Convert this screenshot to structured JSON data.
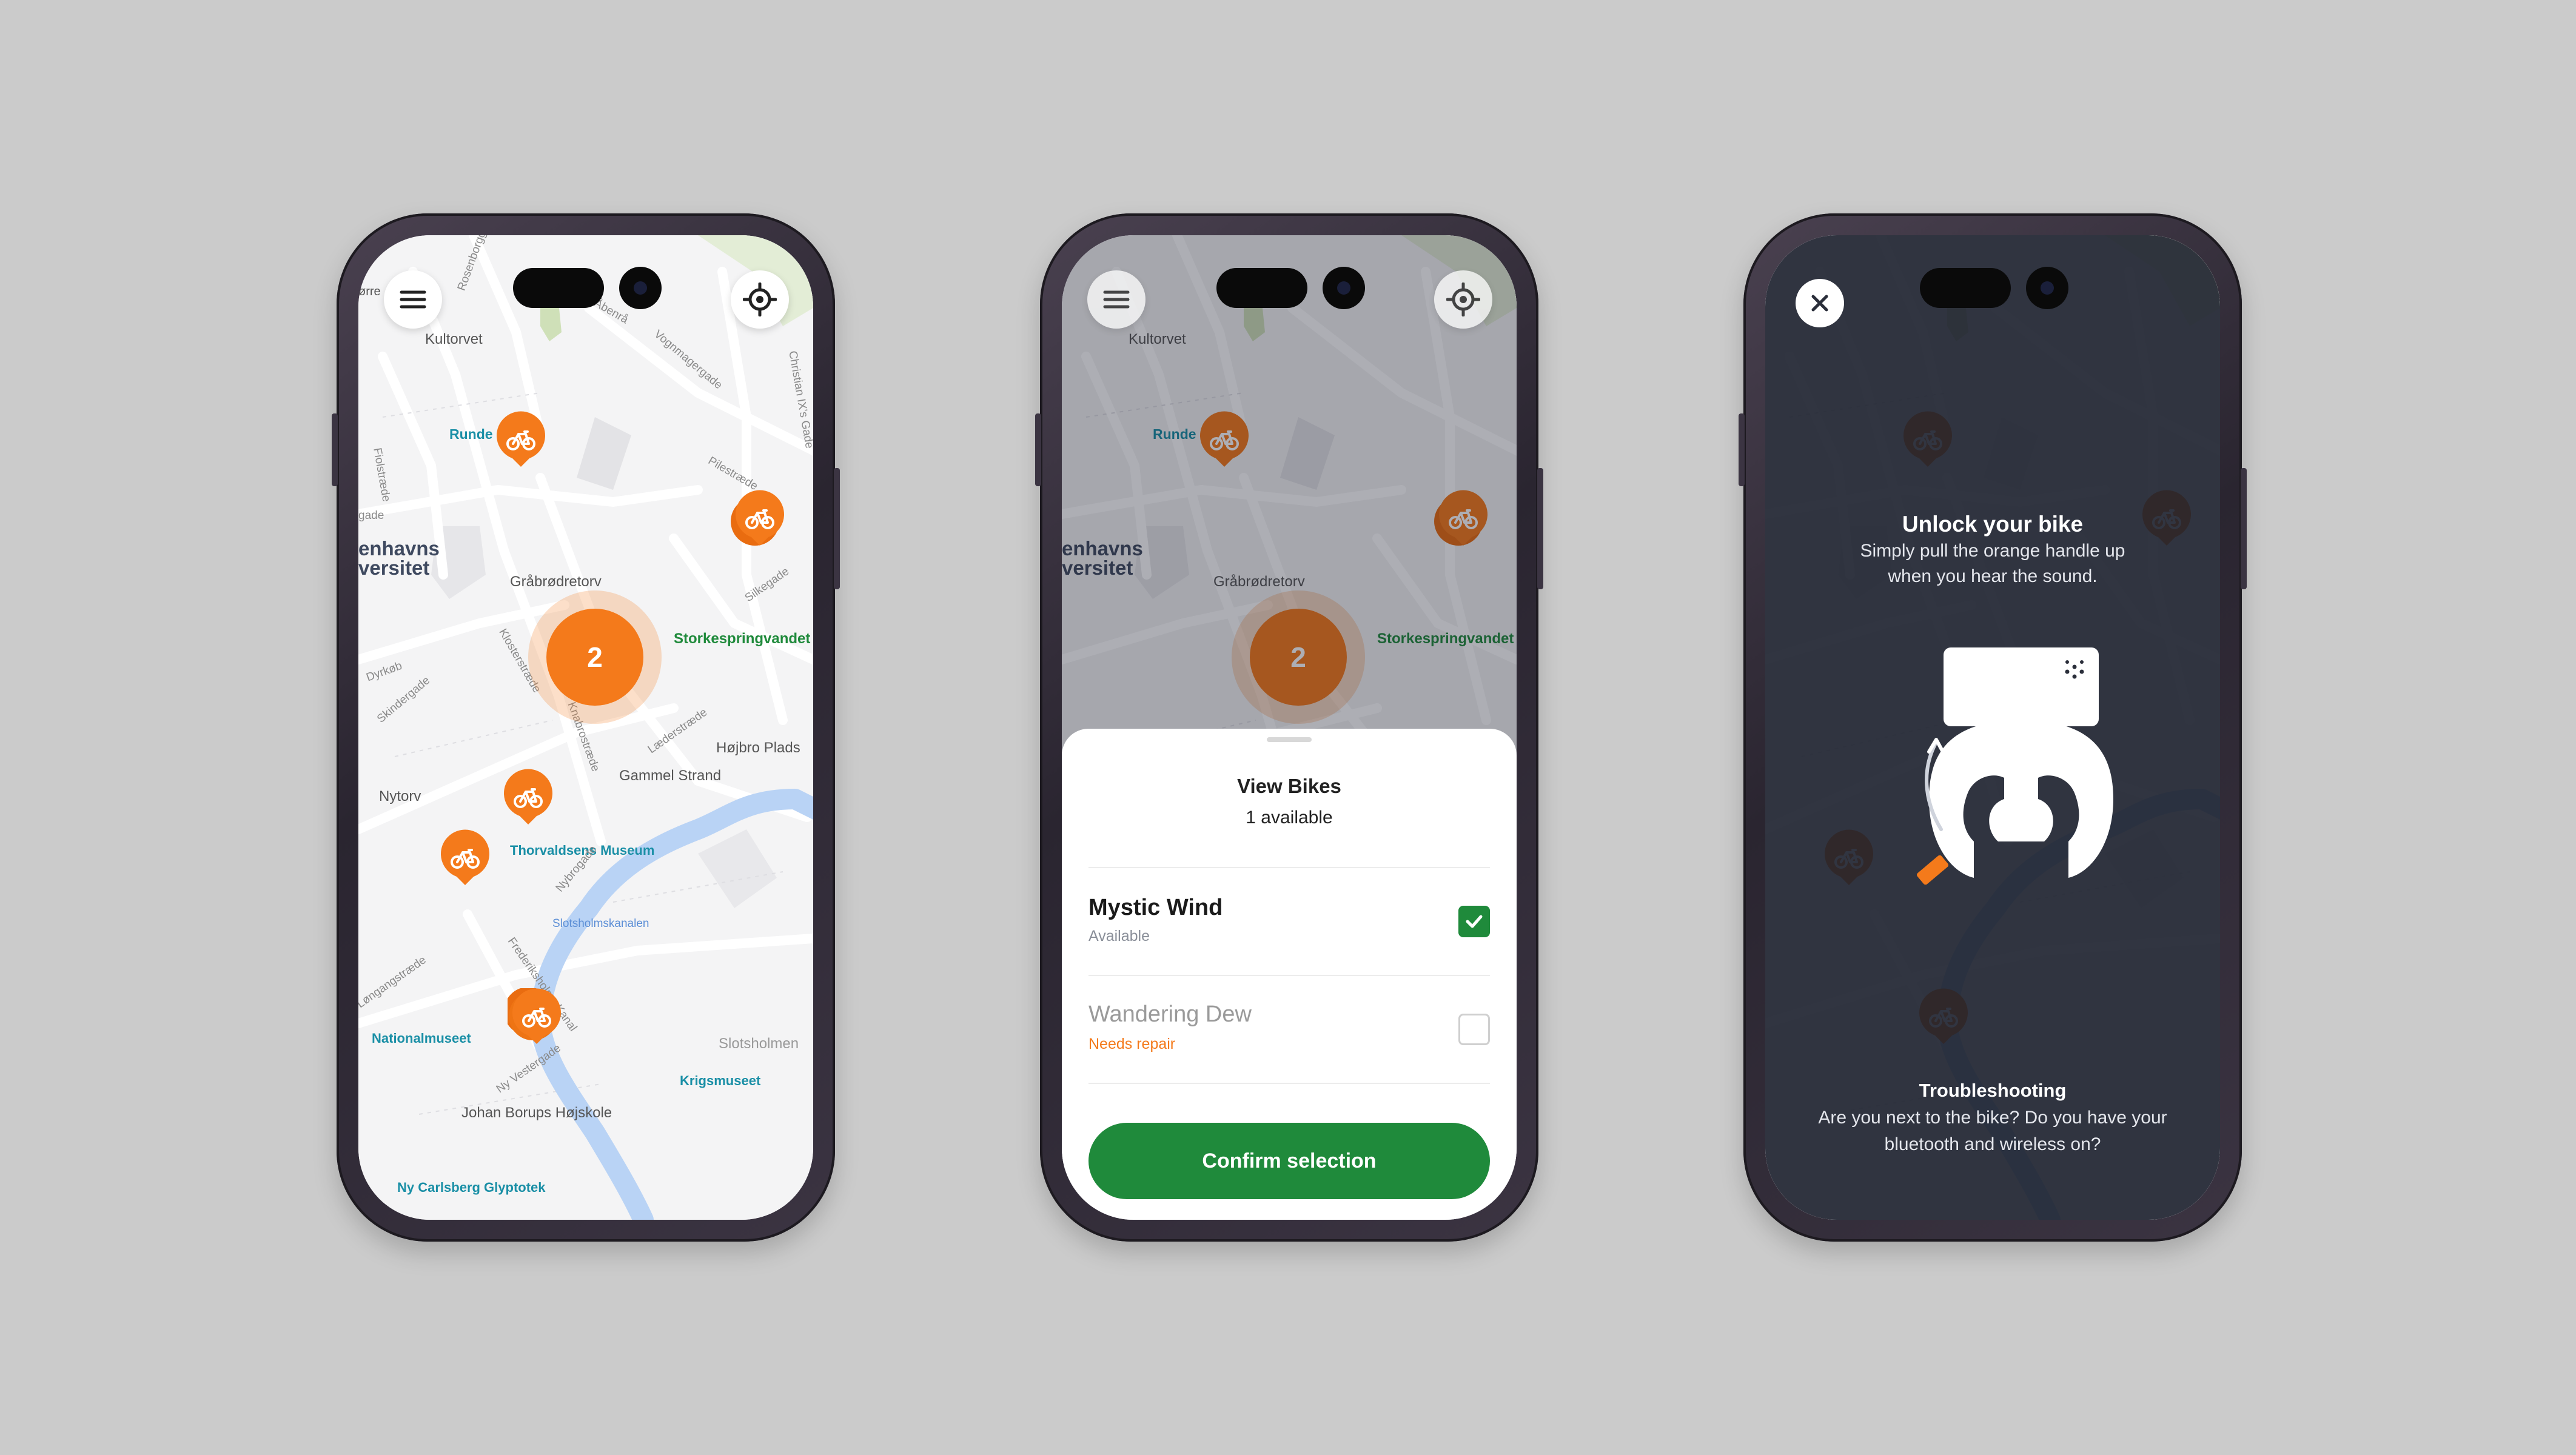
{
  "colors": {
    "background": "#cbcbcb",
    "accent_orange": "#f47a1b",
    "confirm_green": "#1f8a3b",
    "status_needs_repair": "#f47a1b",
    "status_available": "#8a8f99",
    "dark_overlay": "#1b1f2c"
  },
  "icons": {
    "menu": "hamburger-menu-icon",
    "locate": "crosshair-location-icon",
    "bike": "bicycle-icon",
    "check": "checkmark-icon",
    "close": "close-x-icon"
  },
  "map": {
    "labels": {
      "kultorvet": "Kultorvet",
      "runde": "Runde",
      "universitet_line1": "enhavns",
      "universitet_line2": "versitet",
      "grabrodretorv": "Gråbrødretorv",
      "storkespringvandet": "Storkespringvandet",
      "hojbro": "Højbro Plads",
      "gammel_strand": "Gammel Strand",
      "nytorv": "Nytorv",
      "thorvaldsens": "Thorvaldsens Museum",
      "slotsholmskanalen": "Slotsholmskanalen",
      "nationalmuseet": "Nationalmuseet",
      "slotsholmen": "Slotsholmen",
      "krigsmuseet": "Krigsmuseet",
      "johan_borups": "Johan Borups Højskole",
      "glyptotek": "Ny Carlsberg Glyptotek",
      "norre": "ørre"
    },
    "streets": {
      "rosenborggade": "Rosenborggade",
      "abenra": "Åbenrå",
      "vognmagergade": "Vognmagergade",
      "christian_ix": "Christian IX's Gade",
      "fiolstraede": "Fiolstræde",
      "pilestraede": "Pilestræde",
      "silkegade": "Silkegade",
      "klosterstraede": "Klosterstræde",
      "dyrkob": "Dyrkøb",
      "skindergade": "Skindergade",
      "laederstraede": "Læderstræde",
      "knabrostraede": "Knabrostræde",
      "nybrogade": "Nybrogade",
      "frederiksholms": "Frederiksholms Kanal",
      "langangstraede": "Løngangstræde",
      "ny_vestergade": "Ny Vestergade",
      "gade": "gade"
    },
    "cluster_count": "2"
  },
  "sheet": {
    "title": "View Bikes",
    "subtitle": "1 available",
    "bikes": [
      {
        "name": "Mystic Wind",
        "status": "Available",
        "selected": true
      },
      {
        "name": "Wandering Dew",
        "status": "Needs repair",
        "selected": false
      }
    ],
    "confirm_label": "Confirm selection"
  },
  "unlock": {
    "title": "Unlock your bike",
    "subtitle": "Simply pull the orange handle up when you hear the sound.",
    "troubleshooting_title": "Troubleshooting",
    "troubleshooting_text": "Are you next to the bike? Do you have your bluetooth and wireless on?"
  }
}
